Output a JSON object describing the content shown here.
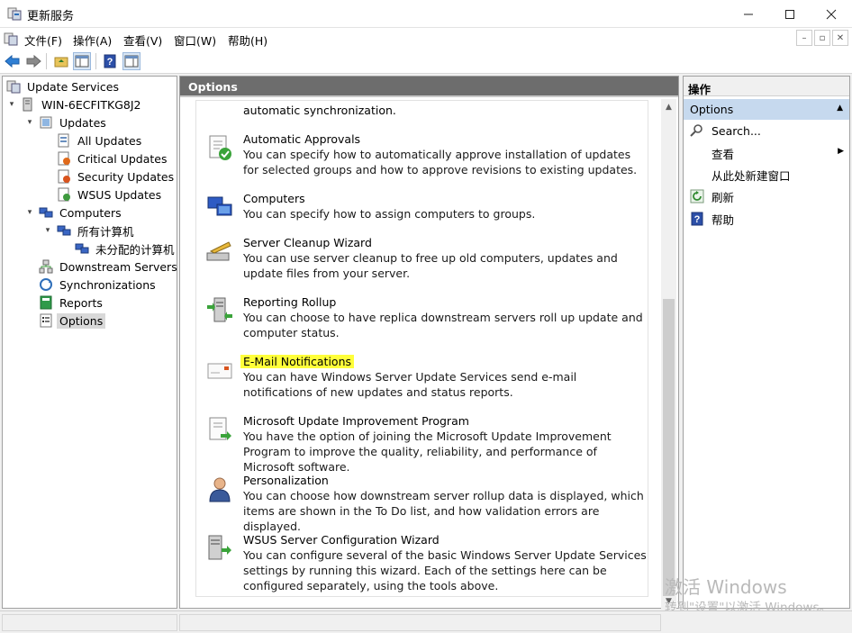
{
  "window": {
    "title": "更新服务",
    "minimize_icon": "minimize-icon",
    "maximize_icon": "maximize-icon",
    "close_icon": "close-icon"
  },
  "menubar": {
    "items": [
      "文件(F)",
      "操作(A)",
      "查看(V)",
      "窗口(W)",
      "帮助(H)"
    ]
  },
  "toolbar": {
    "buttons": [
      "back-arrow-icon",
      "forward-arrow-icon",
      "up-folder-icon",
      "show-hide-tree-icon",
      "help-icon",
      "show-hide-action-pane-icon"
    ]
  },
  "tree": {
    "root": "Update Services",
    "server": "WIN-6ECFITKG8J2",
    "updates": "Updates",
    "all_updates": "All Updates",
    "critical_updates": "Critical Updates",
    "security_updates": "Security Updates",
    "wsus_updates": "WSUS Updates",
    "computers": "Computers",
    "all_computers": "所有计算机",
    "unassigned_computers": "未分配的计算机",
    "downstream_servers": "Downstream Servers",
    "synchronizations": "Synchronizations",
    "reports": "Reports",
    "options": "Options"
  },
  "center": {
    "header": "Options",
    "partial_top_text": "automatic synchronization.",
    "items": [
      {
        "title": "Automatic Approvals",
        "desc": "You can specify how to automatically approve installation of updates for selected groups and how to approve revisions to existing updates.",
        "icon": "approval-checklist-icon"
      },
      {
        "title": "Computers",
        "desc": "You can specify how to assign computers to groups.",
        "icon": "computers-icon"
      },
      {
        "title": "Server Cleanup Wizard",
        "desc": "You can use server cleanup to free up old computers, updates and update files from your server.",
        "icon": "cleanup-broom-icon"
      },
      {
        "title": "Reporting Rollup",
        "desc": "You can choose to have replica downstream servers roll up update and computer status.",
        "icon": "rollup-servers-icon"
      },
      {
        "title": "E-Mail Notifications",
        "desc": "You can have Windows Server Update Services send e-mail notifications of new updates and status reports.",
        "icon": "email-envelope-icon"
      },
      {
        "title": "Microsoft Update Improvement Program",
        "desc": "You have the option of joining the Microsoft Update Improvement Program to improve the quality, reliability, and performance of Microsoft software.",
        "icon": "improvement-program-icon"
      },
      {
        "title": "Personalization",
        "desc": "You can choose how downstream server rollup data is displayed, which items are shown in the To Do list, and how validation errors are displayed.",
        "icon": "person-icon"
      },
      {
        "title": "WSUS Server Configuration Wizard",
        "desc": "You can configure several of the basic Windows Server Update Services settings by running this wizard. Each of the settings here can be configured separately, using the tools above.",
        "icon": "config-wizard-icon"
      }
    ]
  },
  "actions": {
    "header": "操作",
    "section": "Options",
    "items": [
      "Search...",
      "查看",
      "从此处新建窗口",
      "刷新",
      "帮助"
    ]
  },
  "watermark": {
    "line1": "激活 Windows",
    "line2": "转到\"设置\"以激活 Windows。"
  },
  "colors": {
    "highlight": "#ffff3a",
    "header_bg": "#6d6d6d",
    "action_section_bg": "#c6d9ee"
  }
}
